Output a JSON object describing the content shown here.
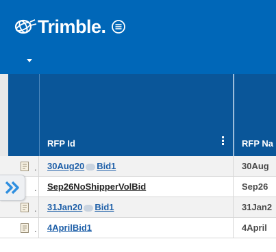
{
  "header": {
    "brand": "Trimble.",
    "colors": {
      "primary": "#0067b8",
      "grid_header": "#0a5699",
      "link": "#1e5fa8"
    }
  },
  "icons": {
    "logo": "trimble-globe-icon",
    "menu": "menu-list-icon",
    "user_menu": "caret-down-icon",
    "kebab": "kebab-icon",
    "row": "document-icon",
    "expand": "double-chevron-right-icon"
  },
  "grid": {
    "columns": [
      {
        "label": "RFP Id"
      },
      {
        "label": "RFP Na"
      }
    ],
    "rows": [
      {
        "id_start": "30Aug20",
        "id_end": "Bid1",
        "redacted": true,
        "name": "30Aug",
        "link": true
      },
      {
        "id_start": "Sep26NoShipperVolBid",
        "id_end": "",
        "redacted": false,
        "name": "Sep26",
        "link": false
      },
      {
        "id_start": "31Jan20",
        "id_end": "Bid1",
        "redacted": true,
        "name": "31Jan2",
        "link": true
      },
      {
        "id_start": "4AprilBid1",
        "id_end": "",
        "redacted": false,
        "name": "4April",
        "link": true
      }
    ]
  }
}
